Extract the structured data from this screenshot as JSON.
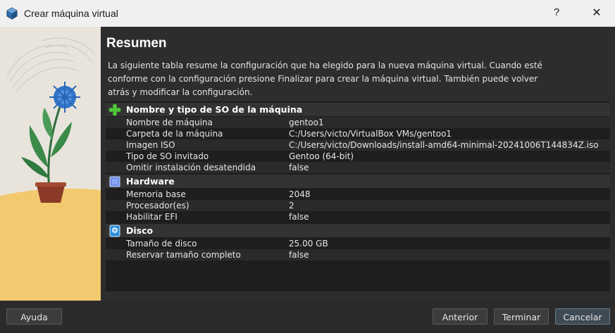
{
  "window": {
    "title": "Crear máquina virtual",
    "help_label": "?",
    "close_label": "✕"
  },
  "page": {
    "heading": "Resumen",
    "description": "La siguiente tabla resume la configuración que ha elegido para la nueva máquina virtual. Cuando esté conforme con la configuración presione Finalizar para crear la máquina virtual. También puede volver atrás y modificar la configuración."
  },
  "summary": {
    "general": {
      "title": "Nombre y tipo de SO de la máquina",
      "icon": "puzzle-icon",
      "rows": [
        {
          "key": "Nombre de máquina",
          "value": "gentoo1"
        },
        {
          "key": "Carpeta de la máquina",
          "value": "C:/Users/victo/VirtualBox VMs/gentoo1"
        },
        {
          "key": "Imagen ISO",
          "value": "C:/Users/victo/Downloads/install-amd64-minimal-20241006T144834Z.iso"
        },
        {
          "key": "Tipo de SO invitado",
          "value": "Gentoo (64-bit)"
        },
        {
          "key": "Omitir instalación desatendida",
          "value": "false"
        }
      ]
    },
    "hardware": {
      "title": "Hardware",
      "icon": "chip-icon",
      "rows": [
        {
          "key": "Memoria base",
          "value": "2048"
        },
        {
          "key": "Procesador(es)",
          "value": "2"
        },
        {
          "key": "Habilitar EFI",
          "value": "false"
        }
      ]
    },
    "disk": {
      "title": "Disco",
      "icon": "disk-icon",
      "rows": [
        {
          "key": "Tamaño de disco",
          "value": "25.00 GB"
        },
        {
          "key": "Reservar tamaño completo",
          "value": "false"
        }
      ]
    }
  },
  "buttons": {
    "help": "Ayuda",
    "back": "Anterior",
    "finish": "Terminar",
    "cancel": "Cancelar"
  },
  "colors": {
    "background": "#2b2b2b",
    "panel": "#1e1e1e",
    "section_row": "#333333",
    "primary_button": "#3e4a54"
  }
}
